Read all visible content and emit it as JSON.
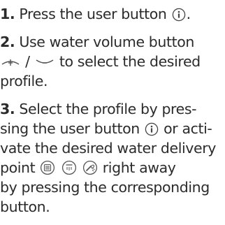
{
  "steps": [
    {
      "number": "1.",
      "lines": [
        {
          "before": "Press the user button",
          "icon": "user-info-icon",
          "after": "."
        }
      ]
    },
    {
      "number": "2.",
      "lines": [
        {
          "text": "Use water volume button"
        },
        {
          "icon_a": "water-volume-increase-icon",
          "separator": "/",
          "icon_b": "water-volume-decrease-icon",
          "text": "to select the desired"
        },
        {
          "text": "profile."
        }
      ]
    },
    {
      "number": "3.",
      "lines": [
        {
          "text": "Select the profile by pres-"
        },
        {
          "before": "sing the user button",
          "icon": "user-info-icon",
          "after": "or acti-"
        },
        {
          "text": "vate the desired water delivery"
        },
        {
          "before": "point",
          "icons": [
            "shower-head-icon",
            "overhead-shower-icon",
            "hand-shower-icon"
          ],
          "after": "right away"
        },
        {
          "text": "by pressing the corresponding"
        },
        {
          "text": "button."
        }
      ]
    }
  ]
}
